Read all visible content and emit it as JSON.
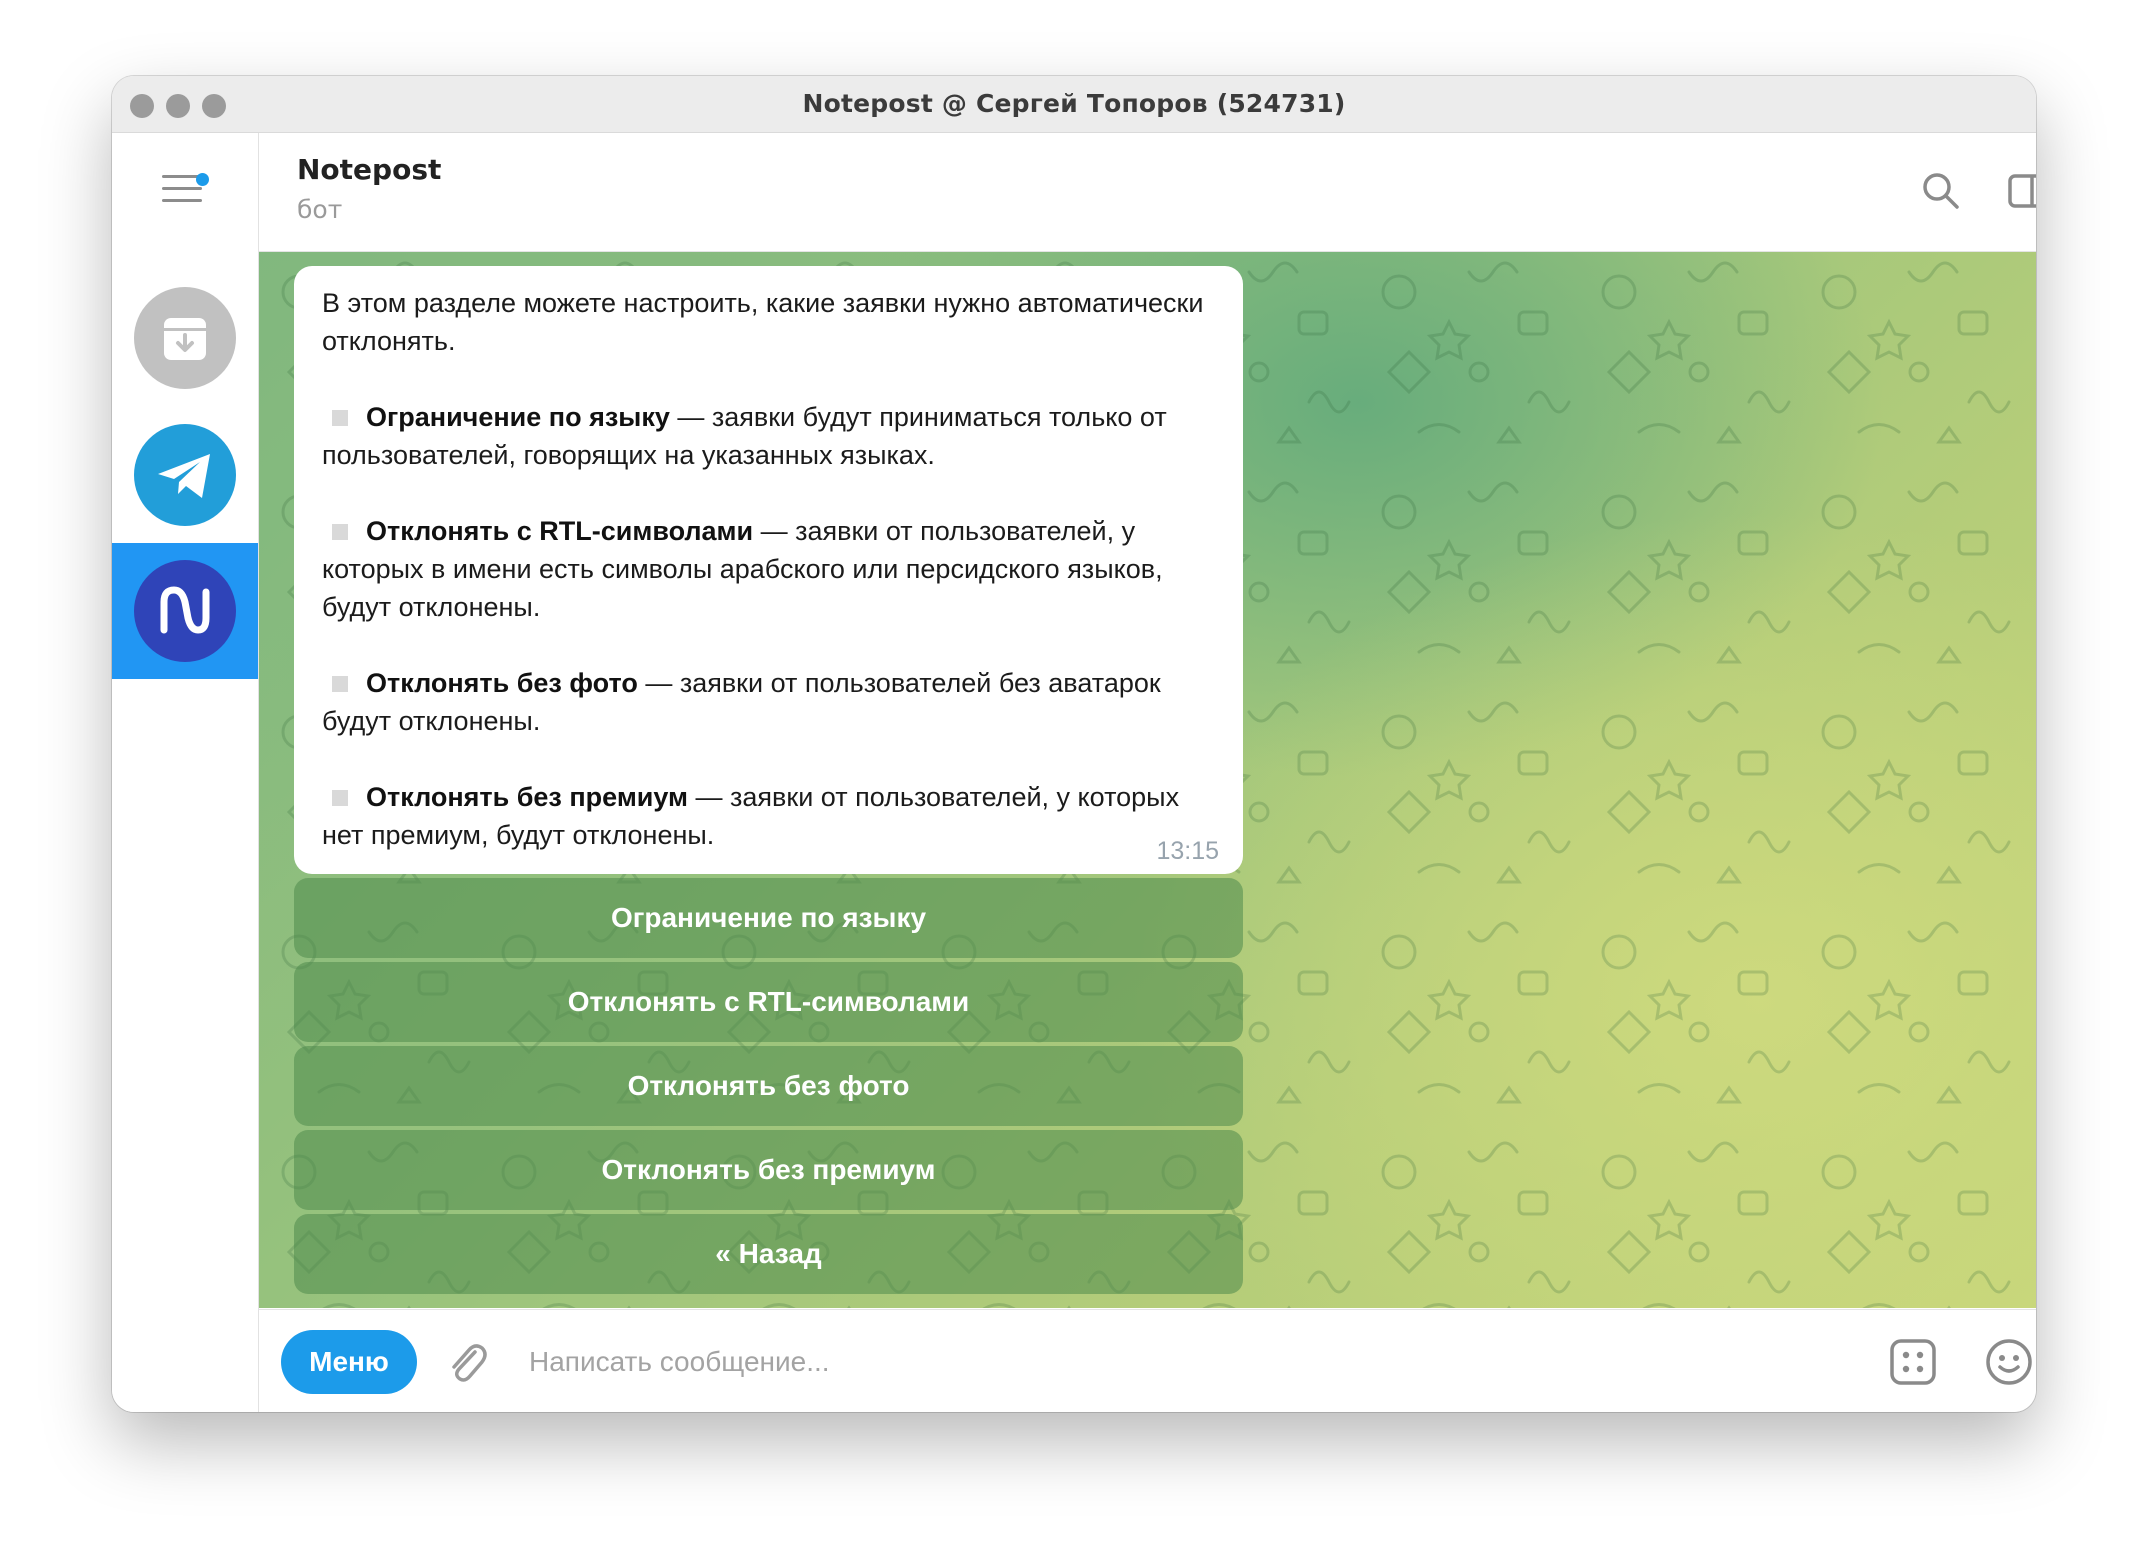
{
  "window": {
    "title": "Notepost @ Сергей Топоров (524731)"
  },
  "sidebar": {
    "menu_icon": "hamburger-menu-icon",
    "folders": [
      {
        "name": "archive",
        "icon": "archive-icon"
      },
      {
        "name": "telegram",
        "icon": "telegram-icon"
      },
      {
        "name": "notepost",
        "icon": "notepost-icon",
        "active": true
      }
    ],
    "active_color": "#2196f3"
  },
  "header": {
    "title": "Notepost",
    "subtitle": "бот",
    "icons": [
      "search-icon",
      "sidebar-toggle-icon",
      "more-icon"
    ]
  },
  "message": {
    "intro": "В этом разделе можете настроить, какие заявки нужно автоматически отклонять.",
    "items": [
      {
        "title": "Ограничение по языку",
        "text": " — заявки будут приниматься только от пользователей, говорящих на указанных языках."
      },
      {
        "title": "Отклонять с RTL-символами",
        "text": " — заявки от пользователей, у которых в имени есть символы арабского или персидского языков, будут отклонены."
      },
      {
        "title": "Отклонять без фото",
        "text": " — заявки от пользователей без аватарок будут отклонены."
      },
      {
        "title": "Отклонять без премиум",
        "text": " — заявки от пользователей, у которых нет премиум, будут отклонены."
      }
    ],
    "time": "13:15"
  },
  "keyboard": [
    "Ограничение по языку",
    "Отклонять с RTL-символами",
    "Отклонять без фото",
    "Отклонять без премиум",
    "« Назад"
  ],
  "composer": {
    "menu_label": "Меню",
    "placeholder": "Написать сообщение...",
    "icons": [
      "attach-icon",
      "commands-icon",
      "emoji-icon",
      "microphone-icon"
    ]
  },
  "colors": {
    "accent": "#1c9bea",
    "wallpaper_start": "#7fb67e",
    "wallpaper_end": "#c7d67a"
  }
}
